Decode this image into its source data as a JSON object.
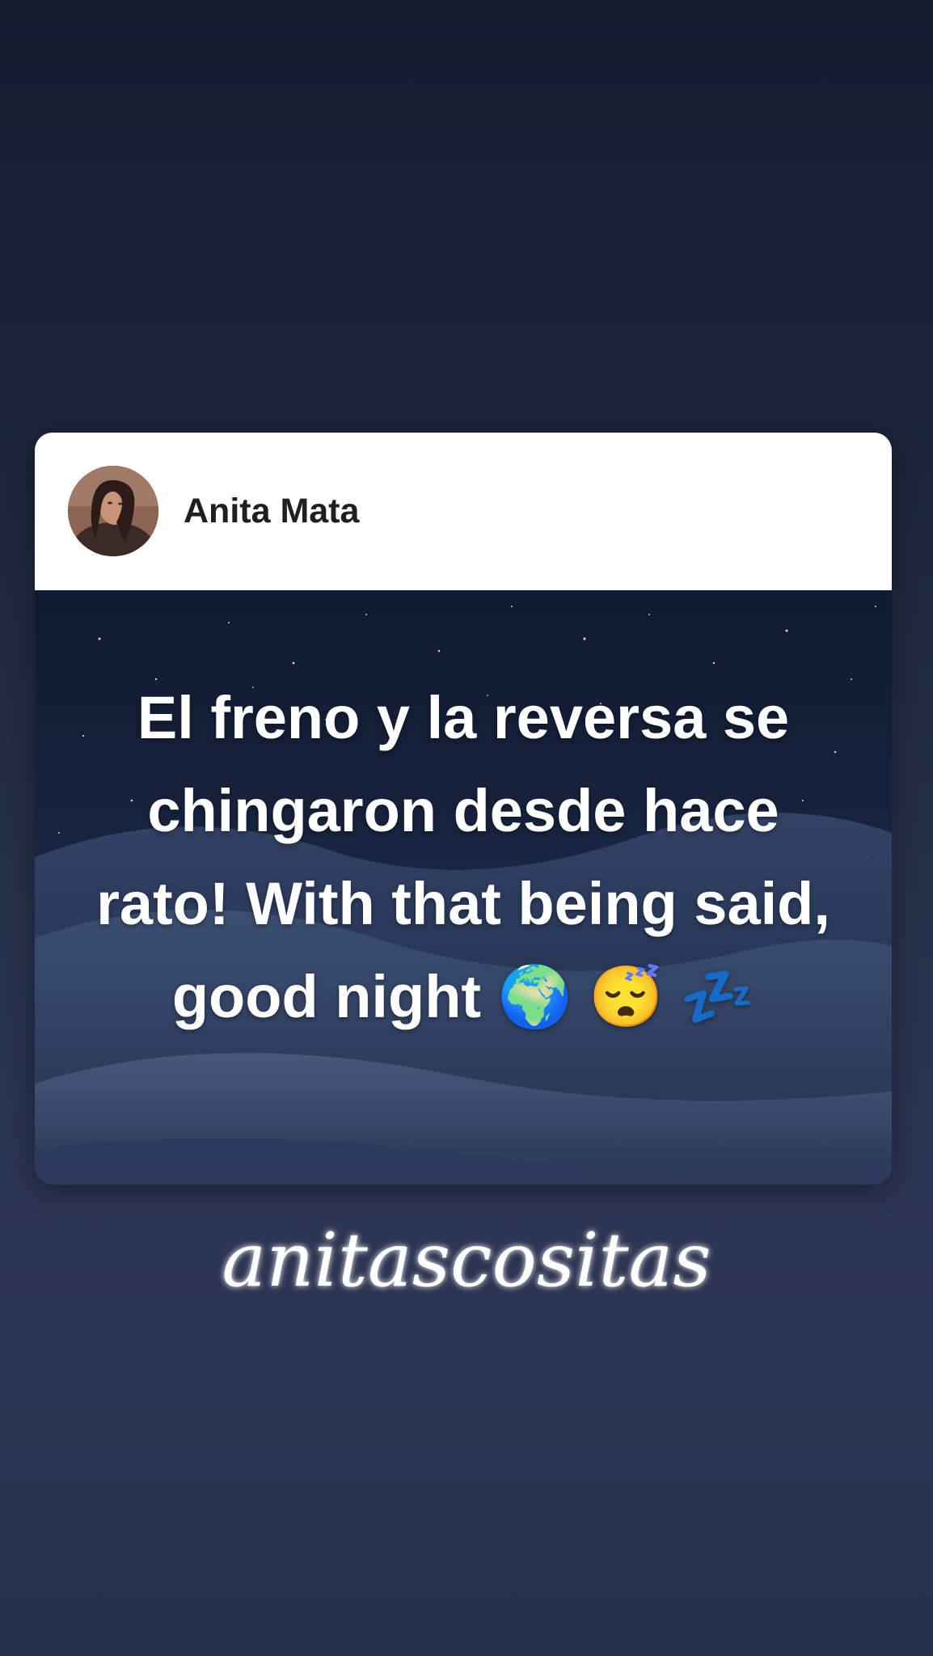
{
  "post": {
    "author_name": "Anita Mata",
    "text": "El freno y la reversa se chingaron desde hace rato! With that being said, good night 🌍 😴 💤"
  },
  "signature": {
    "text": "anitascositas"
  },
  "colors": {
    "background_top": "#141c30",
    "background_bottom": "#2c3552",
    "card_header": "#ffffff",
    "post_text": "#ffffff"
  },
  "icons": {
    "avatar": "profile-photo"
  }
}
